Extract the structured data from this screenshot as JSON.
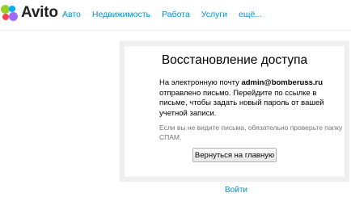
{
  "header": {
    "logo_text": "Avito",
    "nav": [
      {
        "label": "Авто"
      },
      {
        "label": "Недвижимость"
      },
      {
        "label": "Работа"
      },
      {
        "label": "Услуги"
      },
      {
        "label": "ещё..."
      }
    ]
  },
  "recovery": {
    "title": "Восстановление доступа",
    "message_before": "На электронную почту ",
    "email": "admin@bomberuss.ru",
    "message_after": " отправлено письмо. Перейдите по ссылке в письме, чтобы задать новый пароль от вашей учетной записи.",
    "note": "Если вы не видите письма, обязательно проверьте папку СПАМ.",
    "return_button_label": "Вернуться на главную"
  },
  "footer": {
    "login_link": "Войти"
  },
  "colors": {
    "link": "#0091d9",
    "logo_green": "#97cf26",
    "logo_blue": "#00aaff",
    "logo_red": "#ff4053",
    "logo_purple": "#a169f7"
  }
}
